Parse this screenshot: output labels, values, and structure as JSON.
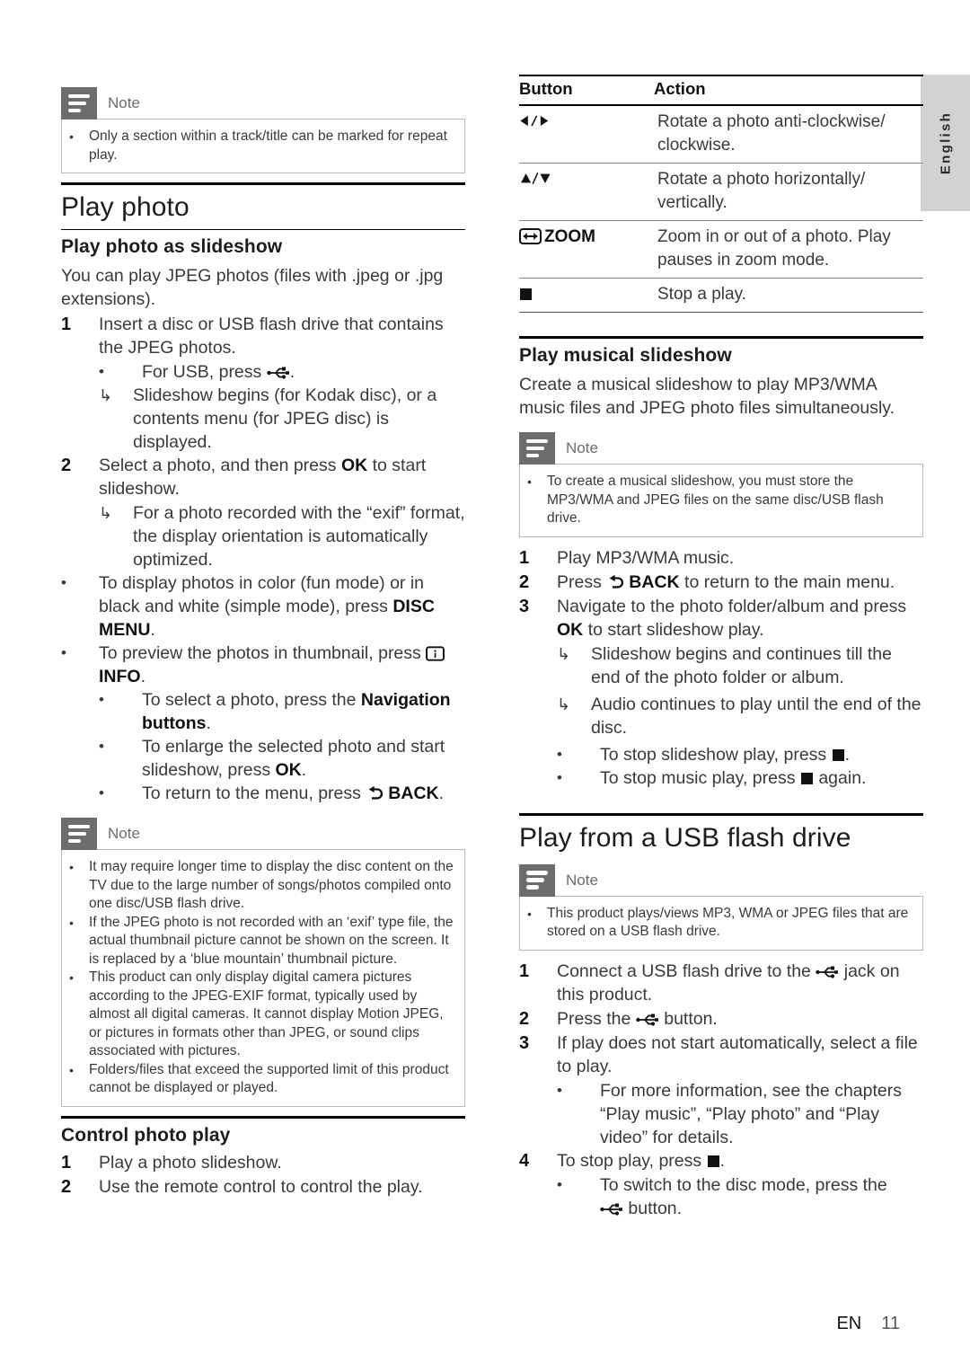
{
  "document": {
    "language_tab": "English",
    "footer": {
      "lang_code": "EN",
      "page_number": "11"
    }
  },
  "left_column": {
    "note_repeat": {
      "title": "Note",
      "items": [
        "Only a section within a track/title can be marked for repeat play."
      ]
    },
    "heading_play_photo": "Play photo",
    "heading_slideshow": "Play photo as slideshow",
    "intro": "You can play JPEG photos (files with .jpeg or .jpg extensions).",
    "step1_num": "1",
    "step1_text": "Insert a disc or USB flash drive that contains the JPEG photos.",
    "step1_bullet_usb_pre": "For USB, press",
    "step1_bullet_usb_post": ".",
    "step1_arrow": "Slideshow begins (for Kodak disc), or a contents menu (for JPEG disc) is displayed.",
    "step2_num": "2",
    "step2_text_pre": "Select a photo, and then press",
    "step2_bold": "OK",
    "step2_text_post": "to start slideshow.",
    "step2_arrow": "For a photo recorded with the “exif” format, the display orientation is automatically optimized.",
    "bullet_discmenu_pre": "To display photos in color (fun mode) or in black and white (simple mode), press",
    "bullet_discmenu_bold": "DISC MENU",
    "bullet_discmenu_post": ".",
    "bullet_info_pre": "To preview the photos in thumbnail, press",
    "bullet_info_bold": "INFO",
    "bullet_info_post": ".",
    "bullet_nav_pre": "To select a photo, press the",
    "bullet_nav_bold": "Navigation buttons",
    "bullet_nav_post": ".",
    "bullet_enlarge_pre": "To enlarge the selected photo and start slideshow, press",
    "bullet_enlarge_bold": "OK",
    "bullet_enlarge_post": ".",
    "bullet_return_pre": "To return to the menu, press",
    "bullet_return_bold": "BACK",
    "bullet_return_post": ".",
    "note_photo": {
      "title": "Note",
      "items": [
        "It may require longer time to display the disc content on the TV due to the large number of songs/photos compiled onto one disc/USB flash drive.",
        "If the JPEG photo is not recorded with an ‘exif’ type file, the actual thumbnail picture cannot be shown on the screen. It is replaced by a ‘blue mountain’ thumbnail picture.",
        "This product can only display digital camera pictures according to the JPEG-EXIF format, typically used by almost all digital cameras. It cannot display Motion JPEG, or pictures in formats other than JPEG, or sound clips associated with pictures.",
        "Folders/files that exceed the supported limit of this product cannot be displayed or played."
      ]
    },
    "heading_control": "Control photo play",
    "control_step1_num": "1",
    "control_step1_text": "Play a photo slideshow.",
    "control_step2_num": "2",
    "control_step2_text": "Use the remote control to control the play."
  },
  "right_column": {
    "table": {
      "headers": [
        "Button",
        "Action"
      ],
      "rows": [
        {
          "button_icon": "left-right-arrows-icon",
          "button_label": "",
          "action": "Rotate a photo anti-clockwise/ clockwise."
        },
        {
          "button_icon": "up-down-arrows-icon",
          "button_label": "",
          "action": "Rotate a photo horizontally/ vertically."
        },
        {
          "button_icon": "zoom-icon",
          "button_label": "ZOOM",
          "action": "Zoom in or out of a photo. Play pauses in zoom mode."
        },
        {
          "button_icon": "stop-icon",
          "button_label": "",
          "action": "Stop a play."
        }
      ]
    },
    "heading_musical": "Play musical slideshow",
    "musical_intro": "Create a musical slideshow to play MP3/WMA music files and JPEG photo files simultaneously.",
    "note_musical": {
      "title": "Note",
      "items": [
        "To create a musical slideshow, you must store the MP3/WMA and JPEG files on the same disc/USB flash drive."
      ]
    },
    "m_step1_num": "1",
    "m_step1_text": "Play MP3/WMA music.",
    "m_step2_num": "2",
    "m_step2_pre": "Press",
    "m_step2_bold": "BACK",
    "m_step2_post": "to return to the main menu.",
    "m_step3_num": "3",
    "m_step3_pre": "Navigate to the photo folder/album and press",
    "m_step3_bold": "OK",
    "m_step3_post": "to start slideshow play.",
    "m_arrow1": "Slideshow begins and continues till the end of the photo folder or album.",
    "m_arrow2": "Audio continues to play until the end of the disc.",
    "m_bullet_stop_slideshow_pre": "To stop slideshow play, press",
    "m_bullet_stop_slideshow_post": ".",
    "m_bullet_stop_music_pre": "To stop music play, press",
    "m_bullet_stop_music_post": "again.",
    "heading_usb": "Play from a USB flash drive",
    "note_usb": {
      "title": "Note",
      "items": [
        "This product plays/views MP3, WMA or JPEG files that are stored on a USB flash drive."
      ]
    },
    "u_step1_num": "1",
    "u_step1_pre": "Connect a USB flash drive to the",
    "u_step1_post": "jack on this product.",
    "u_step2_num": "2",
    "u_step2_pre": "Press the",
    "u_step2_post": "button.",
    "u_step3_num": "3",
    "u_step3_text": "If play does not start automatically, select a file to play.",
    "u_step3_bullet": "For more information, see the chapters “Play music”, “Play photo” and “Play video” for details.",
    "u_step4_num": "4",
    "u_step4_pre": "To stop play, press",
    "u_step4_post": ".",
    "u_step4_bullet_pre": "To switch to the disc mode, press the",
    "u_step4_bullet_post": "button."
  }
}
